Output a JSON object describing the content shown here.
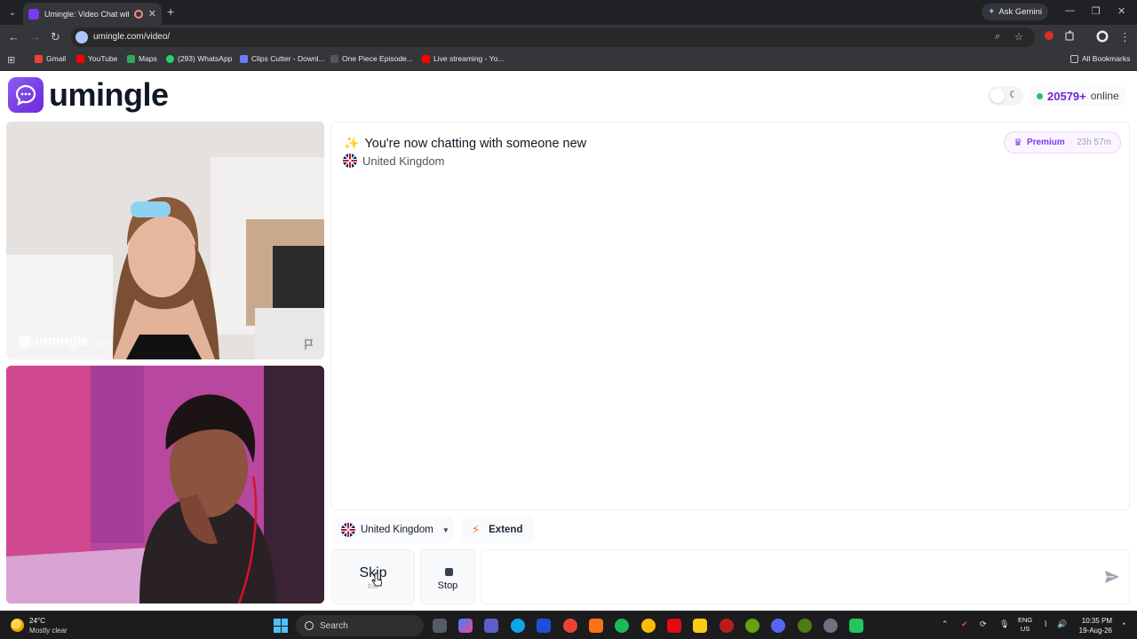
{
  "browser": {
    "tab_title": "Umingle: Video Chat with St",
    "gemini_label": "Ask Gemini",
    "url": "umingle.com/video/",
    "bookmarks": [
      {
        "label": "Gmail",
        "color": "#ea4335"
      },
      {
        "label": "YouTube",
        "color": "#ff0000"
      },
      {
        "label": "Maps",
        "color": "#34a853"
      },
      {
        "label": "(293) WhatsApp",
        "color": "#25d366"
      },
      {
        "label": "Clips Cutter - Downl...",
        "color": "#6b7cff"
      },
      {
        "label": "One Piece Episode...",
        "color": "#444444"
      },
      {
        "label": "Live streaming - Yo...",
        "color": "#ff0000"
      }
    ],
    "all_bookmarks": "All Bookmarks"
  },
  "site": {
    "logo_text": "umingle",
    "online_count": "20579+",
    "online_label": "online",
    "brand_color": "#7c3aed"
  },
  "video": {
    "watermark_text": "umingle",
    "watermark_suffix": ".com"
  },
  "chat": {
    "title": "You're now chatting with someone new",
    "country": "United Kingdom",
    "premium_label": "Premium",
    "premium_separator": "·",
    "premium_timer": "23h 57m"
  },
  "controls": {
    "country_filter": "United Kingdom",
    "extend_label": "Extend",
    "skip_label": "Skip",
    "skip_key": "Esc",
    "stop_label": "Stop",
    "message_placeholder": ""
  },
  "taskbar": {
    "temperature": "24°C",
    "weather": "Mostly clear",
    "search_placeholder": "Search",
    "lang_1": "ENG",
    "lang_2": "US",
    "time": "10:35 PM",
    "date": "19-Aug-26"
  }
}
